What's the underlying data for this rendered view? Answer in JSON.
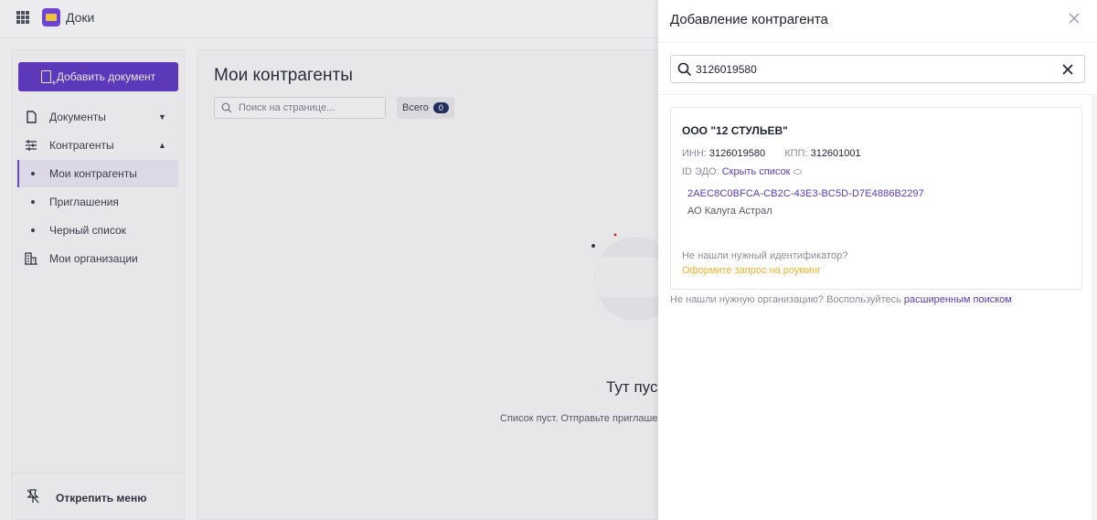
{
  "app": {
    "title": "Доки"
  },
  "sidebar": {
    "add_button_label": "Добавить документ",
    "items": [
      {
        "label": "Документы",
        "chevron": "down"
      },
      {
        "label": "Контрагенты",
        "chevron": "up"
      },
      {
        "label": "Мои контрагенты",
        "active": true
      },
      {
        "label": "Приглашения"
      },
      {
        "label": "Черный список"
      },
      {
        "label": "Мои организации"
      }
    ],
    "unpin_label": "Открепить меню"
  },
  "main": {
    "title": "Мои контрагенты",
    "search_placeholder": "Поиск на странице...",
    "total_label": "Всего",
    "total_count": "0",
    "empty_title": "Тут пуст",
    "empty_text": "Список пуст. Отправьте приглаше"
  },
  "panel": {
    "title": "Добавление контрагента",
    "search_value": "3126019580",
    "result": {
      "org_name": "ООО \"12 СТУЛЬЕВ\"",
      "inn_label": "ИНН:",
      "inn_value": "3126019580",
      "kpp_label": "КПП:",
      "kpp_value": "312601001",
      "edo_label": "ID ЭДО:",
      "edo_toggle": "Скрыть список",
      "edo_id": "2AEC8C0BFCA-CB2C-43E3-BC5D-D7E4886B2297",
      "edo_operator": "АО Калуга Астрал",
      "not_found_id": "Не нашли нужный идентификатор?",
      "roaming_link": "Оформите запрос на роуминг"
    },
    "footer_text": "Не нашли нужную организацию? Воспользуйтесь",
    "footer_link": "расширенным поиском"
  },
  "colors": {
    "accent": "#5b39b8",
    "warning_link": "#f2b32a",
    "badge": "#1f2f5a"
  }
}
